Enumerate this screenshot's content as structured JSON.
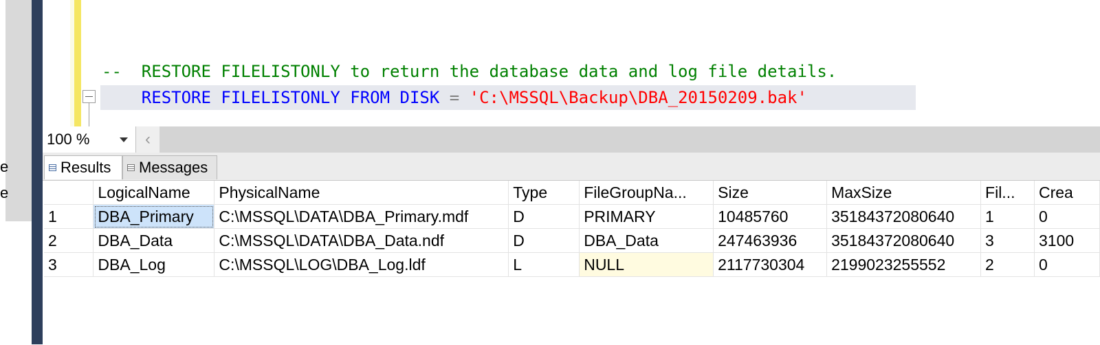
{
  "left_fragments": [
    "e",
    "e"
  ],
  "editor": {
    "comment_line": "--  RESTORE FILELISTONLY to return the database data and log file details.",
    "code": {
      "kw1": "RESTORE",
      "kw2": "FILELISTONLY",
      "kw3": "FROM",
      "kw4": "DISK",
      "op": "=",
      "str": "'C:\\MSSQL\\Backup\\DBA_20150209.bak'"
    }
  },
  "zoom": {
    "value": "100 %"
  },
  "tabs": [
    {
      "label": "Results"
    },
    {
      "label": "Messages"
    }
  ],
  "grid": {
    "headers": [
      "",
      "LogicalName",
      "PhysicalName",
      "Type",
      "FileGroupNa...",
      "Size",
      "MaxSize",
      "Fil...",
      "Crea"
    ],
    "rows": [
      [
        "1",
        "DBA_Primary",
        "C:\\MSSQL\\DATA\\DBA_Primary.mdf",
        "D",
        "PRIMARY",
        "10485760",
        "35184372080640",
        "1",
        "0"
      ],
      [
        "2",
        "DBA_Data",
        "C:\\MSSQL\\DATA\\DBA_Data.ndf",
        "D",
        "DBA_Data",
        "247463936",
        "35184372080640",
        "3",
        "3100"
      ],
      [
        "3",
        "DBA_Log",
        "C:\\MSSQL\\LOG\\DBA_Log.ldf",
        "L",
        "NULL",
        "2117730304",
        "2199023255552",
        "2",
        "0"
      ]
    ]
  },
  "colors": {
    "comment": "#008000",
    "keyword": "#0000ff",
    "string": "#ff0000",
    "operator": "#808080",
    "nav_bar": "#2e3f5c",
    "gutter_yellow": "#f5e662",
    "selected_cell": "#cde3fa",
    "null_cell": "#fffbe0"
  }
}
